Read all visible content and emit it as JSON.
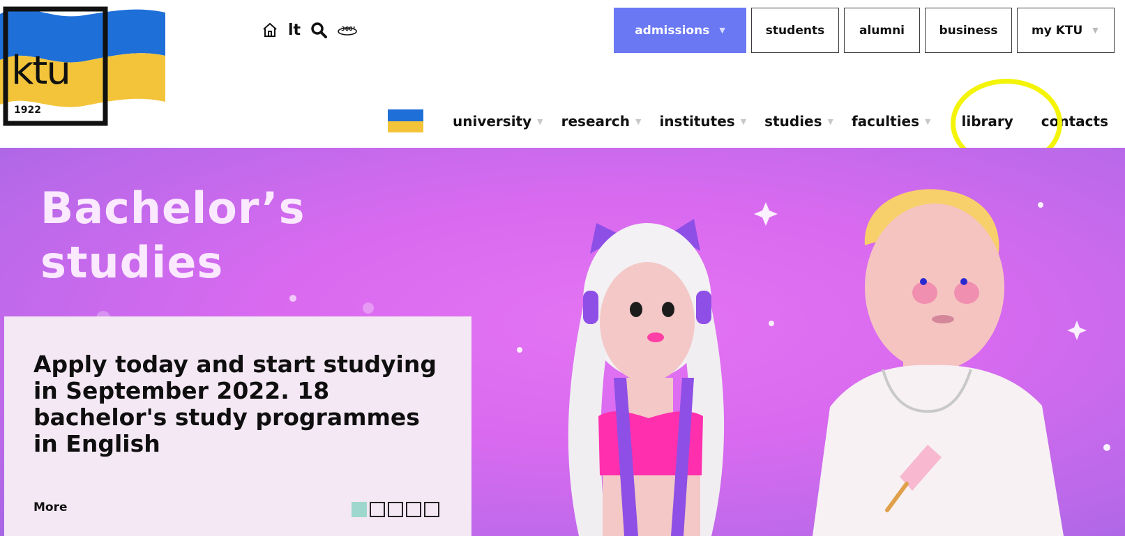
{
  "logo": {
    "word": "ktu",
    "year": "1922",
    "alt": "KTU logo with Ukrainian flag"
  },
  "utilities": {
    "home_icon": "home-icon",
    "language": "lt",
    "search_icon": "search-icon",
    "tour_icon": "360-view-icon",
    "tour_label": "360°"
  },
  "top_buttons": [
    {
      "label": "admissions",
      "active": true,
      "has_dropdown": true
    },
    {
      "label": "students",
      "active": false,
      "has_dropdown": false
    },
    {
      "label": "alumni",
      "active": false,
      "has_dropdown": false
    },
    {
      "label": "business",
      "active": false,
      "has_dropdown": false
    },
    {
      "label": "my KTU",
      "active": false,
      "has_dropdown": true
    }
  ],
  "main_nav": [
    {
      "label": "university",
      "has_dropdown": true
    },
    {
      "label": "research",
      "has_dropdown": true
    },
    {
      "label": "institutes",
      "has_dropdown": true
    },
    {
      "label": "studies",
      "has_dropdown": true
    },
    {
      "label": "faculties",
      "has_dropdown": true
    },
    {
      "label": "library",
      "has_dropdown": false
    },
    {
      "label": "contacts",
      "has_dropdown": false
    }
  ],
  "hero": {
    "title_line1": "Bachelor’s",
    "title_line2": "studies",
    "card_text": "Apply today and start studying in September 2022. 18 bachelor's study programmes in English",
    "more_label": "More",
    "slides_total": 5,
    "slide_active": 1
  },
  "colors": {
    "accent": "#6a78f4",
    "hero_bg": "#d96af0",
    "card_bg": "#f4e8f4",
    "highlight": "#f4f40a",
    "flag_blue": "#1f6fd8",
    "flag_yellow": "#f3c43a",
    "active_dot": "#9ed7cd"
  }
}
